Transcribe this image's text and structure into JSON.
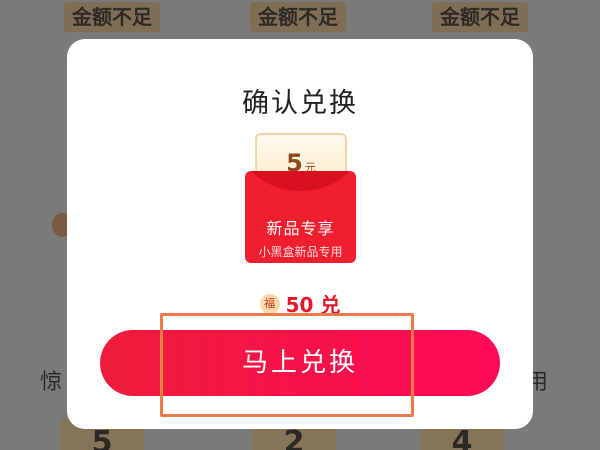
{
  "background": {
    "chips": [
      "金额不足",
      "金额不足",
      "金额不足"
    ],
    "left_text": "惊",
    "right_text": "用",
    "cards": [
      "5",
      "2",
      "4"
    ]
  },
  "modal": {
    "title": "确认兑换",
    "coupon": {
      "amount": "5",
      "unit": "元",
      "label": "新品专享",
      "sublabel": "小黑盒新品专用"
    },
    "cost": {
      "icon_text": "福",
      "text": "50 兑"
    },
    "button_label": "马上兑换"
  },
  "colors": {
    "accent": "#f01f2f",
    "button": "#ff0a58",
    "highlight": "#ec7a4a"
  }
}
